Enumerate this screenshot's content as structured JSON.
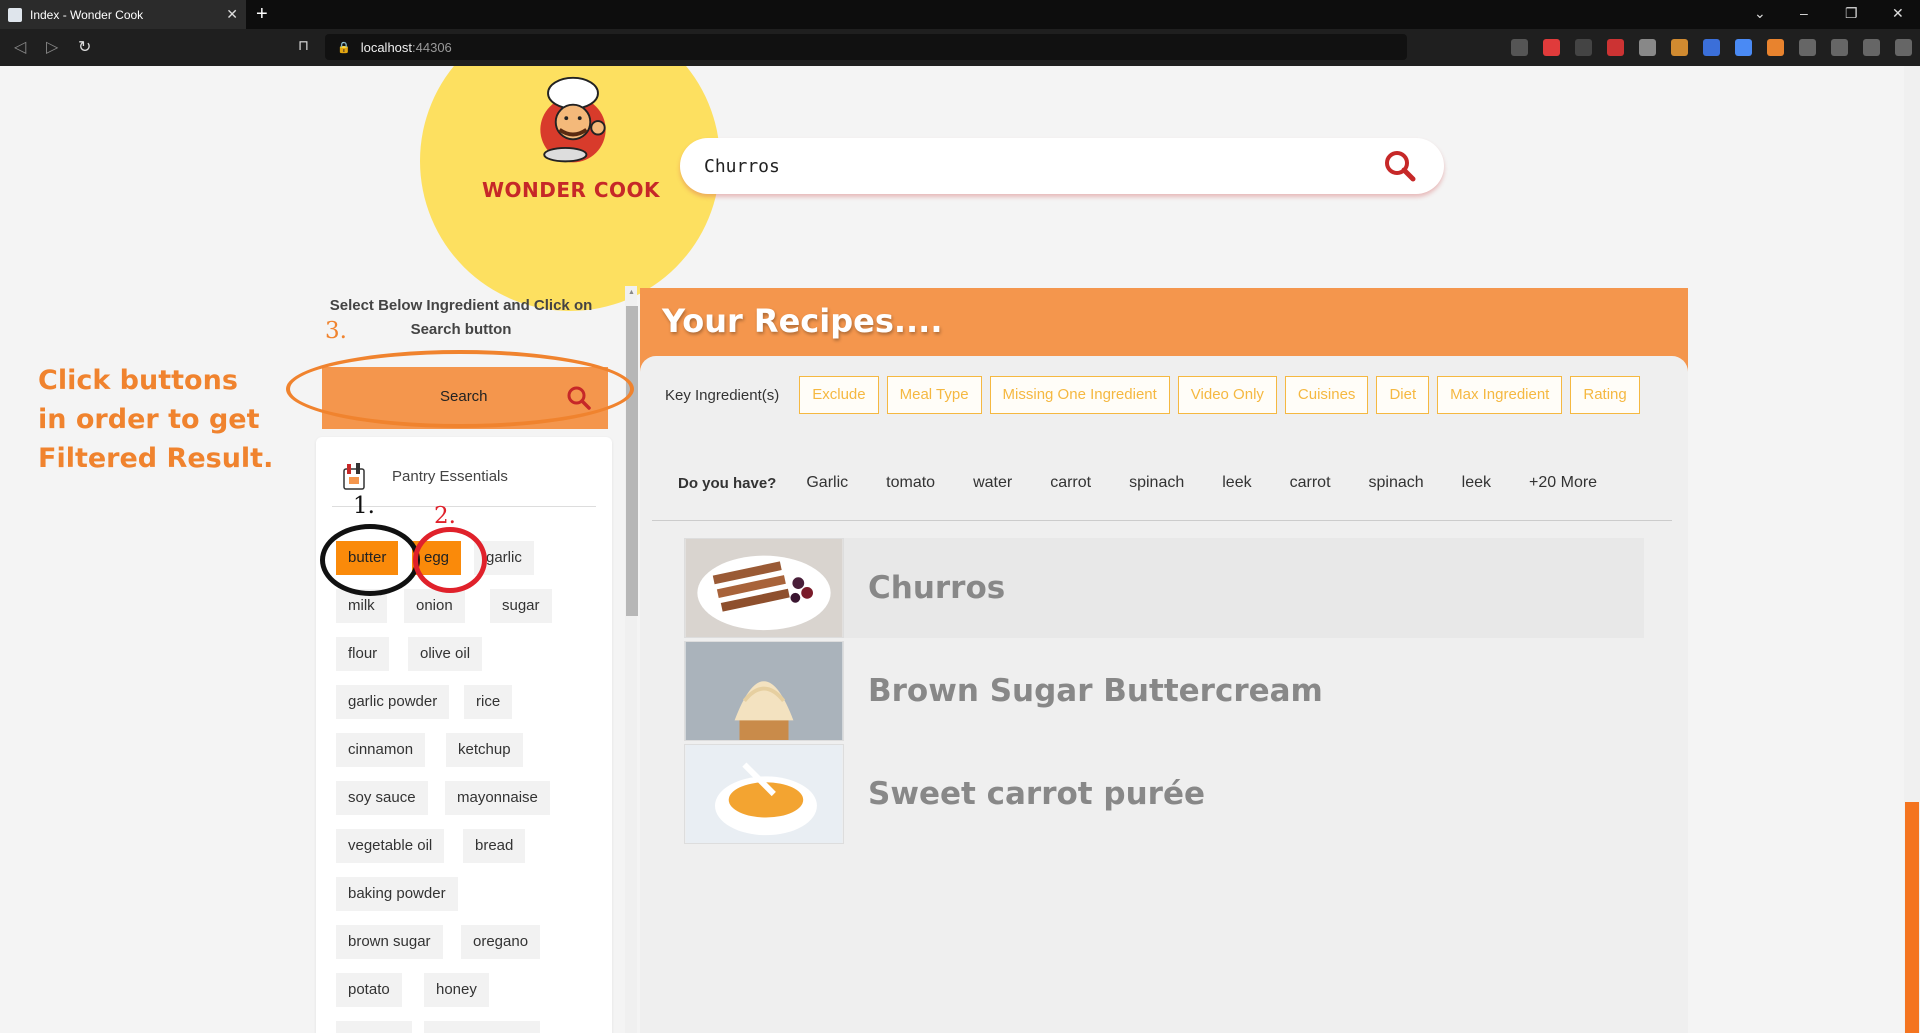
{
  "browser": {
    "tab_title": "Index - Wonder Cook",
    "tab_close": "✕",
    "new_tab": "+",
    "url_host": "localhost",
    "url_port": ":44306"
  },
  "brand": {
    "name": "WONDER COOK"
  },
  "search": {
    "value": "Churros"
  },
  "panel": {
    "instruction": "Select Below Ingredient and Click on Search button",
    "search_button": "Search",
    "pantry_title": "Pantry Essentials",
    "chips": [
      "butter",
      "egg",
      "garlic",
      "milk",
      "onion",
      "sugar",
      "flour",
      "olive oil",
      "garlic powder",
      "rice",
      "cinnamon",
      "ketchup",
      "soy sauce",
      "mayonnaise",
      "vegetable oil",
      "bread",
      "baking powder",
      "brown sugar",
      "oregano",
      "potato",
      "honey"
    ]
  },
  "annotations": {
    "line1": "Click buttons",
    "line2": "in order to get",
    "line3": "Filtered Result.",
    "step1": "1.",
    "step2": "2.",
    "step3": "3."
  },
  "recipes": {
    "header": "Your Recipes....",
    "key_label": "Key Ingredient(s)",
    "filters": [
      "Exclude",
      "Meal Type",
      "Missing One Ingredient",
      "Video Only",
      "Cuisines",
      "Diet",
      "Max Ingredient",
      "Rating"
    ],
    "have_label": "Do you have?",
    "have_items": [
      "Garlic",
      "tomato",
      "water",
      "carrot",
      "spinach",
      "leek",
      "carrot",
      "spinach",
      "leek",
      "+20 More"
    ],
    "list": [
      "Churros",
      "Brown Sugar Buttercream",
      "Sweet carrot purée"
    ]
  },
  "colors": {
    "accent_orange": "#f4964d",
    "selected_chip": "#fa8a0a",
    "filter_tag": "#f5b841",
    "logo_yellow": "#fde060",
    "brand_red": "#c62828"
  }
}
